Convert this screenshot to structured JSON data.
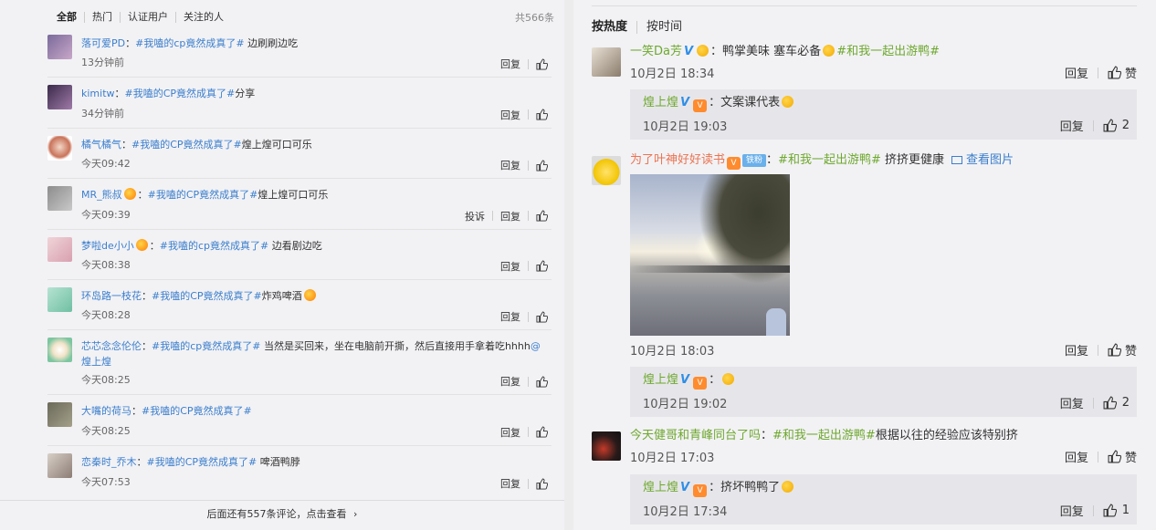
{
  "left": {
    "tabs": [
      "全部",
      "热门",
      "认证用户",
      "关注的人"
    ],
    "total": "共566条",
    "comments": [
      {
        "name": "落可爱PD",
        "sep": "：",
        "tag": "#我嗑的cp竟然成真了#",
        "text": " 边刷刷边吃",
        "time": "13分钟前",
        "report": "",
        "reply": "回复"
      },
      {
        "name": "kimitw",
        "sep": "：",
        "tag": "#我嗑的CP竟然成真了#",
        "text": "分享",
        "time": "34分钟前",
        "report": "",
        "reply": "回复"
      },
      {
        "name": "橘气橘气",
        "sep": "：",
        "tag": "#我嗑的CP竟然成真了#",
        "text": "煌上煌可口可乐",
        "time": "今天09:42",
        "report": "",
        "reply": "回复"
      },
      {
        "name": "MR_熊叔",
        "sep": "：",
        "tag": "#我嗑的CP竟然成真了#",
        "text": "煌上煌可口可乐",
        "time": "今天09:39",
        "report": "投诉",
        "reply": "回复"
      },
      {
        "name": "梦啦de小小",
        "sep": "：",
        "tag": "#我嗑的cp竟然成真了#",
        "text": " 边看剧边吃",
        "time": "今天08:38",
        "report": "",
        "reply": "回复"
      },
      {
        "name": "环岛路一枝花",
        "sep": "：",
        "tag": "#我嗑的CP竟然成真了#",
        "text": "炸鸡啤酒",
        "time": "今天08:28",
        "report": "",
        "reply": "回复"
      },
      {
        "name": "芯芯念念伦伦",
        "sep": "：",
        "tag": "#我嗑的cp竟然成真了#",
        "text": " 当然是买回来，坐在电脑前开撕，然后直接用手拿着吃hhhh",
        "mention": "@煌上煌",
        "time": "今天08:25",
        "report": "",
        "reply": "回复"
      },
      {
        "name": "大嘴的荷马",
        "sep": "：",
        "tag": "#我嗑的CP竟然成真了#",
        "text": "",
        "time": "今天08:25",
        "report": "",
        "reply": "回复"
      },
      {
        "name": "恋秦时_乔木",
        "sep": "：",
        "tag": "#我嗑的CP竟然成真了#",
        "text": " 啤酒鸭脖",
        "time": "今天07:53",
        "report": "",
        "reply": "回复"
      }
    ],
    "more": "后面还有557条评论，点击查看",
    "more_arrow": "›"
  },
  "right": {
    "tabs": [
      "按热度",
      "按时间"
    ],
    "comments": [
      {
        "name": "一笑Da芳",
        "badge": "V",
        "text": "：鸭掌美味 塞车必备",
        "tag": "#和我一起出游鸭#",
        "date": "10月2日 18:34",
        "reply": "回复",
        "like": "赞",
        "sub": {
          "name": "煌上煌",
          "badge": "V",
          "text": "：文案课代表",
          "date": "10月2日 19:03",
          "reply": "回复",
          "count": "2"
        }
      },
      {
        "name": "为了叶神好好读书",
        "fan": "铁粉",
        "text1": "：",
        "tag": "#和我一起出游鸭#",
        "text": " 挤挤更健康",
        "view": "查看图片",
        "date": "10月2日 18:03",
        "reply": "回复",
        "like": "赞",
        "sub": {
          "name": "煌上煌",
          "badge": "V",
          "text": "：",
          "date": "10月2日 19:02",
          "reply": "回复",
          "count": "2"
        }
      },
      {
        "name": "今天健哥和青峰同台了吗",
        "text1": "：",
        "tag": "#和我一起出游鸭#",
        "text": "根据以往的经验应该特别挤",
        "date": "10月2日 17:03",
        "reply": "回复",
        "like": "赞",
        "sub": {
          "name": "煌上煌",
          "badge": "V",
          "text": "：挤坏鸭鸭了",
          "date": "10月2日 17:34",
          "reply": "回复",
          "count": "1"
        }
      }
    ]
  },
  "icons": {
    "thumb": "thumbs-up-icon",
    "image": "image-icon",
    "vip": "vip-crown-icon",
    "verified": "verified-v-icon"
  },
  "colors": {
    "link_blue": "#3b7ecc",
    "name_orange": "#eb7350",
    "topic_green": "#6fa82e",
    "panel_bg": "#f2f2f5",
    "reply_bg": "#e6e6ea"
  }
}
